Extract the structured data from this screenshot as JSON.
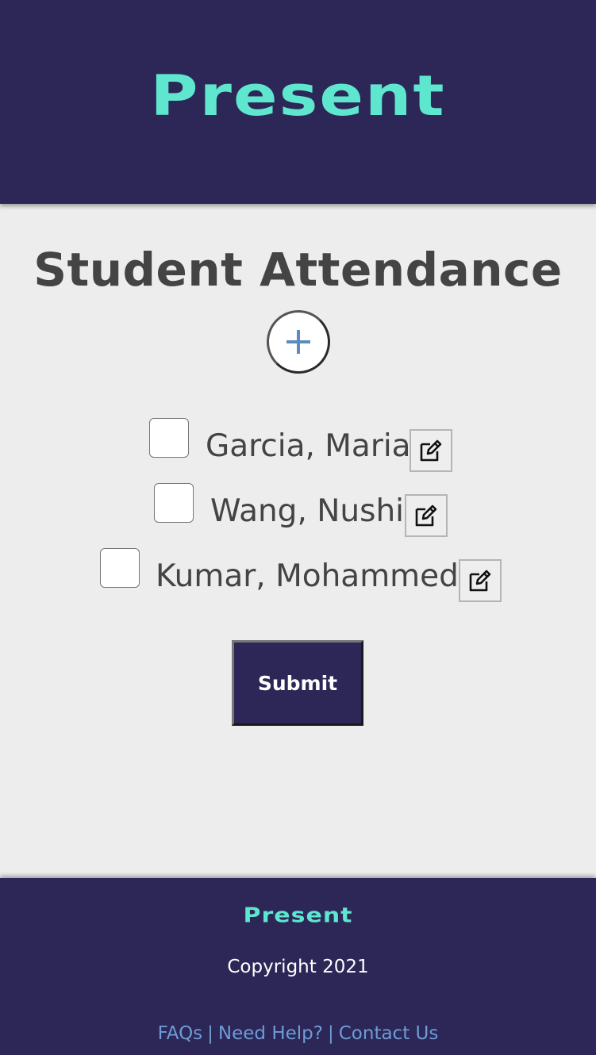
{
  "header": {
    "brand": "Present"
  },
  "main": {
    "title": "Student Attendance",
    "add_button_icon": "plus-icon",
    "students": [
      {
        "name": "Garcia, Maria",
        "checked": false,
        "edit_icon": "edit-icon"
      },
      {
        "name": "Wang, Nushi",
        "checked": false,
        "edit_icon": "edit-icon"
      },
      {
        "name": "Kumar, Mohammed",
        "checked": false,
        "edit_icon": "edit-icon"
      }
    ],
    "submit_label": "Submit"
  },
  "footer": {
    "brand": "Present",
    "copyright": "Copyright 2021",
    "links": {
      "faqs": "FAQs",
      "help": "Need Help?",
      "contact": "Contact Us",
      "separator": "|"
    }
  },
  "colors": {
    "brand_navy": "#2c2757",
    "brand_teal": "#5ee6cf",
    "background": "#ededed",
    "text": "#444444",
    "link": "#6f9bd6",
    "plus_icon": "#5b8cc1"
  }
}
